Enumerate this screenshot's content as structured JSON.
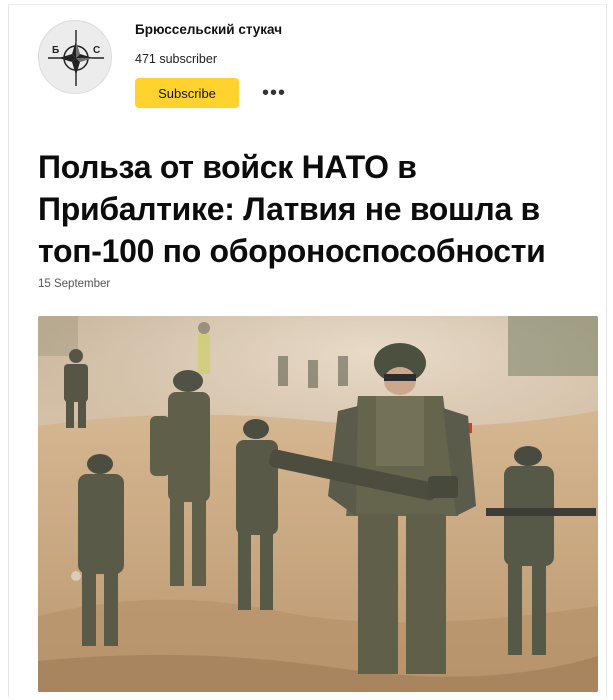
{
  "channel": {
    "name": "Брюссельский стукач",
    "subscribers": "471 subscriber",
    "subscribe_label": "Subscribe",
    "more_label": "•••",
    "avatar_letters": [
      "Б",
      "С"
    ]
  },
  "article": {
    "title": "Польза от войск НАТО в Прибалтике: Латвия не вошла в топ-100 по обороноспособности",
    "date": "15 September"
  },
  "colors": {
    "subscribe_button": "#ffd22e",
    "canadian_flag_red": "#d52b1e"
  },
  "icons": {
    "avatar": "nato-compass-star-icon",
    "more": "more-dots-icon"
  }
}
